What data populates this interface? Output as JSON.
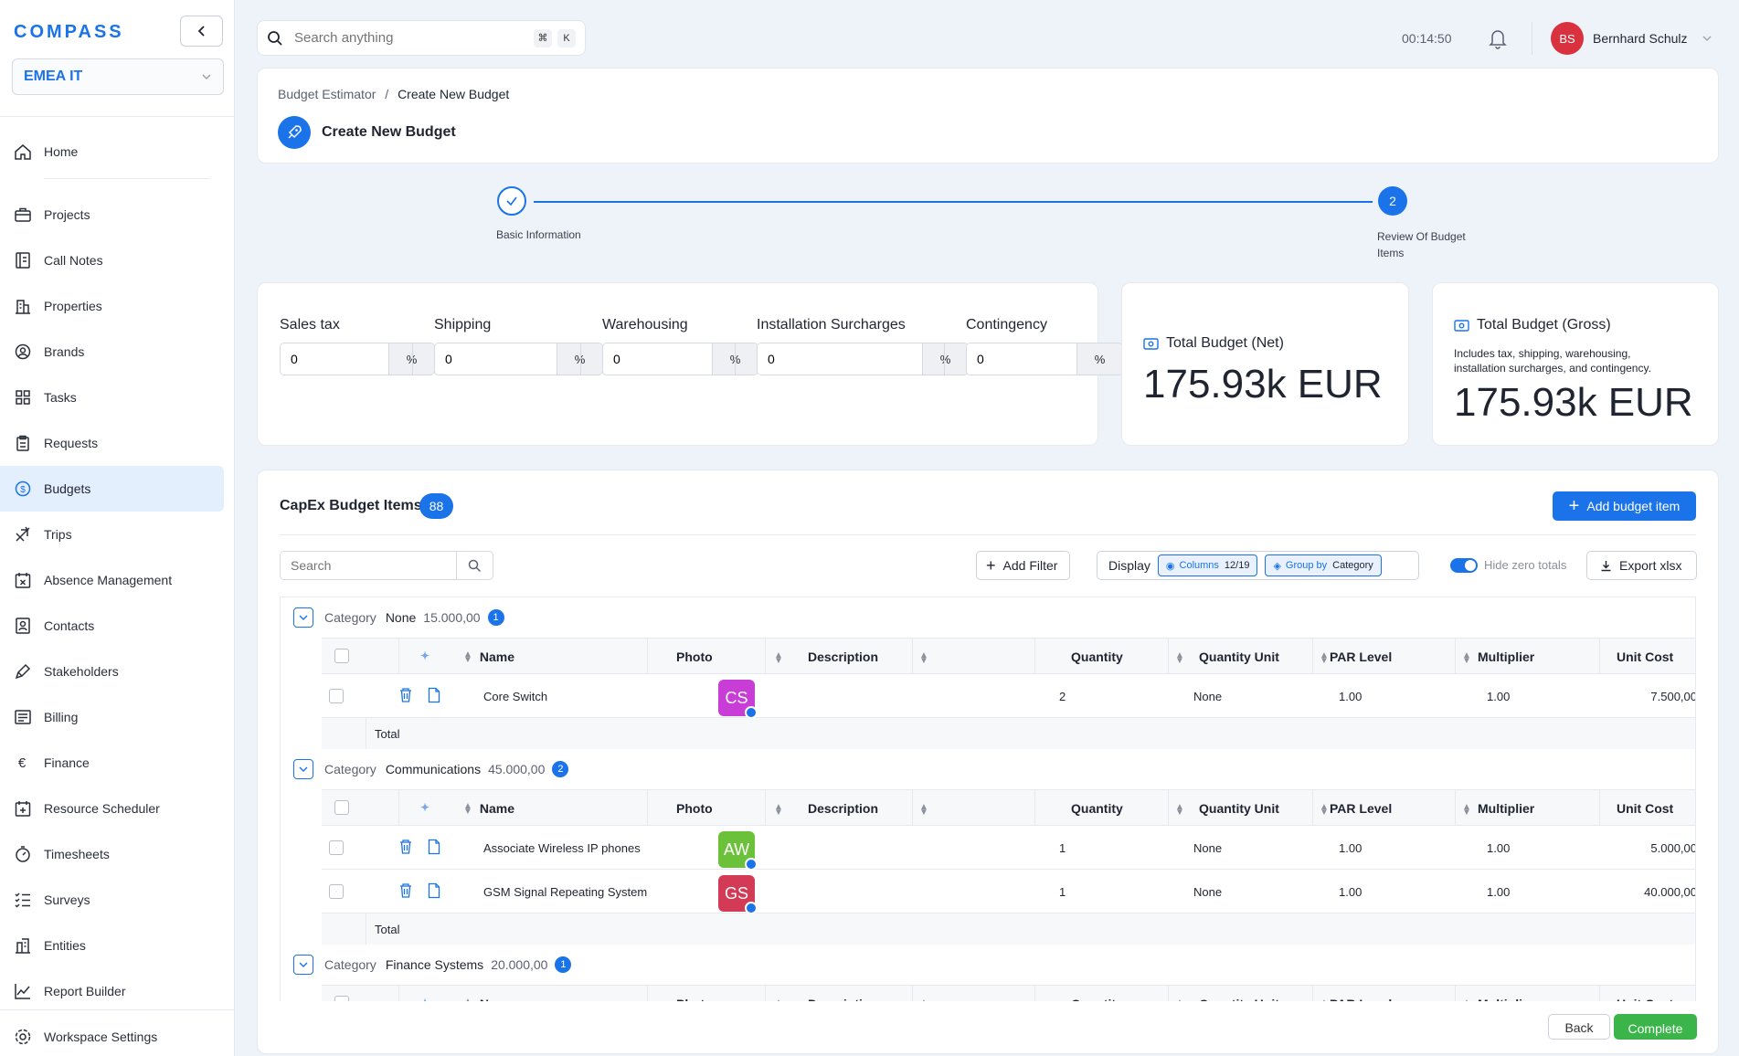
{
  "app": {
    "logo": "COMPASS",
    "org": "EMEA IT"
  },
  "sidebar": {
    "items": [
      {
        "label": "Home",
        "icon": "home-icon"
      },
      {
        "label": "Projects",
        "icon": "briefcase-icon"
      },
      {
        "label": "Call Notes",
        "icon": "notes-icon"
      },
      {
        "label": "Properties",
        "icon": "building-icon"
      },
      {
        "label": "Brands",
        "icon": "badge-icon"
      },
      {
        "label": "Tasks",
        "icon": "grid-icon"
      },
      {
        "label": "Requests",
        "icon": "clipboard-icon"
      },
      {
        "label": "Budgets",
        "icon": "dollar-icon"
      },
      {
        "label": "Trips",
        "icon": "plane-icon"
      },
      {
        "label": "Absence Management",
        "icon": "calendar-x-icon"
      },
      {
        "label": "Contacts",
        "icon": "contact-icon"
      },
      {
        "label": "Stakeholders",
        "icon": "pen-icon"
      },
      {
        "label": "Billing",
        "icon": "billing-icon"
      },
      {
        "label": "Finance",
        "icon": "euro-icon"
      },
      {
        "label": "Resource Scheduler",
        "icon": "calendar-plus-icon"
      },
      {
        "label": "Timesheets",
        "icon": "stopwatch-icon"
      },
      {
        "label": "Surveys",
        "icon": "checklist-icon"
      },
      {
        "label": "Entities",
        "icon": "entities-icon"
      },
      {
        "label": "Report Builder",
        "icon": "chart-icon"
      }
    ],
    "bottom": {
      "label": "Workspace Settings",
      "icon": "gear-icon"
    }
  },
  "topbar": {
    "search_placeholder": "Search anything",
    "kbd1": "⌘",
    "kbd2": "K",
    "timer": "00:14:50",
    "user_initials": "BS",
    "user_name": "Bernhard Schulz"
  },
  "header": {
    "crumb_root": "Budget Estimator",
    "crumb_sep": "/",
    "crumb_current": "Create New Budget",
    "title": "Create New Budget"
  },
  "stepper": {
    "step1": "Basic Information",
    "step2_num": "2",
    "step2": "Review Of Budget Items"
  },
  "taxes": [
    {
      "label": "Sales tax",
      "value": "0",
      "unit": "%"
    },
    {
      "label": "Shipping",
      "value": "0",
      "unit": "%"
    },
    {
      "label": "Warehousing",
      "value": "0",
      "unit": "%"
    },
    {
      "label": "Installation Surcharges",
      "value": "0",
      "unit": "%"
    },
    {
      "label": "Contingency",
      "value": "0",
      "unit": "%"
    }
  ],
  "totals": {
    "net_label": "Total Budget (Net)",
    "net_value": "175.93k EUR",
    "gross_label": "Total Budget (Gross)",
    "gross_note": "Includes tax, shipping, warehousing, installation surcharges, and contingency.",
    "gross_value": "175.93k EUR"
  },
  "capex": {
    "title": "CapEx Budget Items",
    "count": "88",
    "add_button": "Add budget item",
    "search_placeholder": "Search",
    "add_filter": "Add Filter",
    "display": "Display",
    "columns_label": "Columns",
    "columns_value": "12/19",
    "group_label": "Group by",
    "group_value": "Category",
    "hide_zero": "Hide zero totals",
    "export": "Export xlsx",
    "category_label": "Category",
    "total_label": "Total",
    "columns": [
      "Name",
      "Photo",
      "Description",
      "Quantity",
      "Quantity Unit",
      "PAR Level",
      "Multiplier",
      "Unit Cost"
    ],
    "groups": [
      {
        "name": "None",
        "amount": "15.000,00",
        "count": "1",
        "rows": [
          {
            "name": "Core Switch",
            "initials": "CS",
            "color": "#c83dd6",
            "qty": "2",
            "unit": "None",
            "par": "1.00",
            "mult": "1.00",
            "cost": "7.500,00"
          }
        ]
      },
      {
        "name": "Communications",
        "amount": "45.000,00",
        "count": "2",
        "rows": [
          {
            "name": "Associate Wireless IP phones",
            "initials": "AW",
            "color": "#6cc13a",
            "qty": "1",
            "unit": "None",
            "par": "1.00",
            "mult": "1.00",
            "cost": "5.000,00"
          },
          {
            "name": "GSM Signal Repeating System",
            "initials": "GS",
            "color": "#d33a56",
            "qty": "1",
            "unit": "None",
            "par": "1.00",
            "mult": "1.00",
            "cost": "40.000,00"
          }
        ]
      },
      {
        "name": "Finance Systems",
        "amount": "20.000,00",
        "count": "1",
        "rows": []
      }
    ]
  },
  "footer": {
    "back": "Back",
    "complete": "Complete"
  }
}
